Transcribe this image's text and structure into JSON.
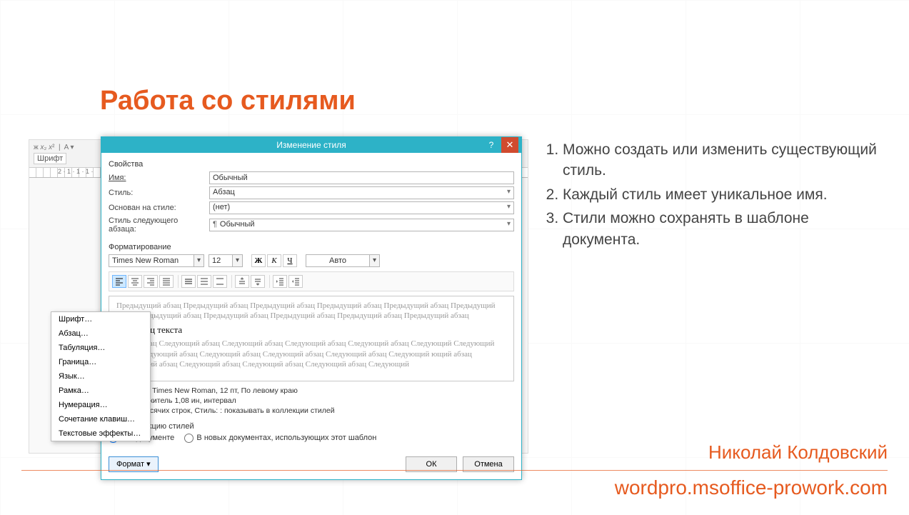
{
  "slide": {
    "title": "Работа со стилями",
    "author": "Николай Колдовский",
    "url": "wordpro.msoffice-prowork.com"
  },
  "bullets": [
    "Можно создать или изменить существующий стиль.",
    "Каждый стиль имеет уникальное имя.",
    "Стили можно сохранять в шаблоне документа."
  ],
  "ribbon": {
    "font_group": "Шрифт",
    "ruler_fragment": "2 · 1 · 1 · 1 ·"
  },
  "dialog": {
    "title": "Изменение стиля",
    "section_props": "Свойства",
    "labels": {
      "name": "Имя:",
      "style": "Стиль:",
      "based_on": "Основан на стиле:",
      "next": "Стиль следующего абзаца:"
    },
    "values": {
      "name": "Обычный",
      "style": "Абзац",
      "based_on": "(нет)",
      "next": "Обычный"
    },
    "section_fmt": "Форматирование",
    "font": {
      "name": "Times New Roman",
      "size": "12",
      "bold": "Ж",
      "italic": "К",
      "underline": "Ч",
      "auto": "Авто"
    },
    "preview": {
      "prev": "Предыдущий абзац Предыдущий абзац Предыдущий абзац Предыдущий абзац Предыдущий абзац Предыдущий абзац Предыдущий абзац Предыдущий абзац Предыдущий абзац Предыдущий абзац Предыдущий абзац",
      "sample": "дин абзац текста",
      "next": "ющий абзац Следующий абзац Следующий абзац Следующий абзац Следующий абзац Следующий Следующий абзац Следующий абзац Следующий абзац Следующий абзац Следующий абзац Следующий ющий абзац Следующий абзац Следующий абзац Следующий абзац Следующий абзац Следующий"
    },
    "desc_line1": "умолчанию) Times New Roman, 12 пт, По левому краю",
    "desc_line2": "очный,  множитель 1,08 ин, интервал",
    "desc_line3": "т, Запрет висячих строк, Стиль: : показывать в коллекции стилей",
    "checks": {
      "add_collection": "в коллекцию стилей",
      "this_doc": "том документе",
      "new_docs": "В новых документах, использующих этот шаблон"
    },
    "buttons": {
      "format": "Формат ▾",
      "ok": "ОК",
      "cancel": "Отмена"
    }
  },
  "context_menu": [
    "Шрифт…",
    "Абзац…",
    "Табуляция…",
    "Граница…",
    "Язык…",
    "Рамка…",
    "Нумерация…",
    "Сочетание клавиш…",
    "Текстовые эффекты…"
  ]
}
